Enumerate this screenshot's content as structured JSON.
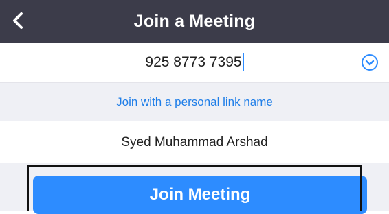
{
  "header": {
    "title": "Join a Meeting",
    "back_icon": "chevron-left-icon"
  },
  "meeting_id": {
    "value": "925 8773 7395",
    "dropdown_icon": "chevron-down-circle-icon"
  },
  "personal_link": {
    "label": "Join with a personal link name"
  },
  "display_name": {
    "value": "Syed Muhammad Arshad"
  },
  "join_button": {
    "label": "Join Meeting"
  },
  "colors": {
    "header_bg": "#3c3c4a",
    "accent": "#2d8cff",
    "link": "#1f7ee8",
    "section_bg": "#eff0f5"
  }
}
